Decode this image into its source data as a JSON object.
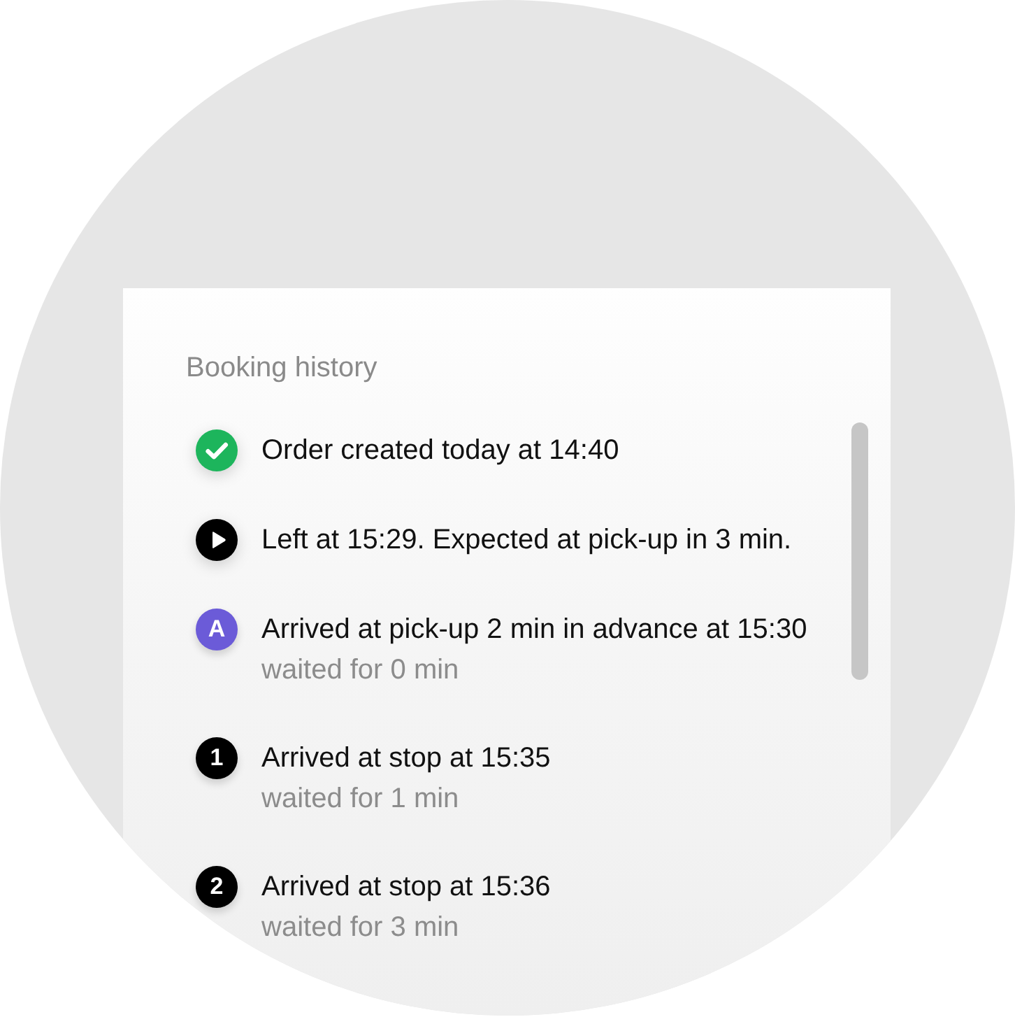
{
  "title": "Booking history",
  "events": [
    {
      "kind": "check",
      "color": "#1db55c",
      "text": "Order created today at 14:40"
    },
    {
      "kind": "play",
      "color": "#000000",
      "text": "Left at 15:29. Expected at pick-up in 3 min."
    },
    {
      "kind": "marker",
      "color": "#6b5bd8",
      "badge": "A",
      "text": "Arrived at pick-up 2 min in advance at 15:30",
      "detail": "waited for 0 min"
    },
    {
      "kind": "marker",
      "color": "#000000",
      "badge": "1",
      "text": "Arrived at stop at 15:35",
      "detail": "waited for 1 min"
    },
    {
      "kind": "marker",
      "color": "#000000",
      "badge": "2",
      "text": "Arrived at stop at 15:36",
      "detail": "waited for 3 min"
    }
  ]
}
